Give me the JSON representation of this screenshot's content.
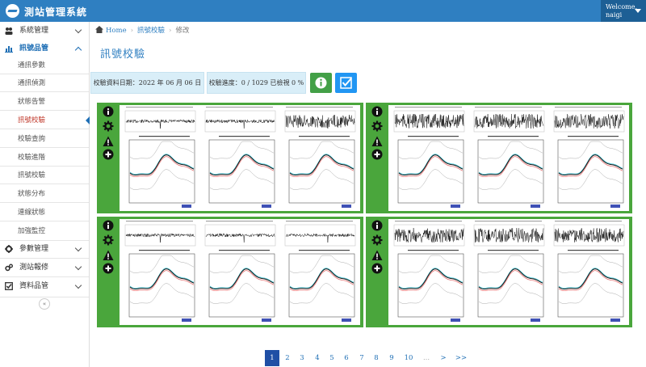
{
  "app": {
    "title": "測站管理系統",
    "welcome": "Welcome,",
    "user": "naigi"
  },
  "sidebar": {
    "groups": [
      {
        "label": "系統管理",
        "icon": "users-icon"
      },
      {
        "label": "訊號品管",
        "icon": "bar-chart-icon"
      },
      {
        "label": "參數管理",
        "icon": "gear-icon"
      },
      {
        "label": "測站報修",
        "icon": "gears-icon"
      },
      {
        "label": "資料品管",
        "icon": "check-square-icon"
      }
    ],
    "items": [
      "通訊參數",
      "通訊偵測",
      "狀態告警",
      "訊號校驗",
      "校驗查詢",
      "校驗進階",
      "訊號校驗",
      "狀態分布",
      "連線狀態",
      "加強監控"
    ],
    "collapse": "«"
  },
  "breadcrumb": {
    "home": "Home",
    "section": "訊號校驗",
    "current": "修改"
  },
  "page": {
    "title": "訊號校驗",
    "date_label": "校驗資料日期：2022 年 06 月 06 日",
    "progress_label": "校驗進度：0 / 1029 已檢視 0 %"
  },
  "colors": {
    "topbar": "#2f7fc1",
    "card_green": "#4aa63c",
    "info_btn": "#43a047",
    "check_btn": "#2196f3",
    "pager_active": "#1f4fa5"
  },
  "cards": [
    {
      "icons": [
        "info-icon",
        "gear-icon",
        "warning-icon",
        "plus-icon"
      ]
    },
    {
      "icons": [
        "info-icon",
        "gear-icon",
        "warning-icon",
        "plus-icon"
      ]
    },
    {
      "icons": [
        "info-icon",
        "gear-icon",
        "warning-icon",
        "plus-icon"
      ]
    },
    {
      "icons": [
        "info-icon",
        "gear-icon",
        "warning-icon",
        "plus-icon"
      ]
    }
  ],
  "pagination": [
    "1",
    "2",
    "3",
    "4",
    "5",
    "6",
    "7",
    "8",
    "9",
    "10",
    "...",
    ">",
    ">>"
  ]
}
